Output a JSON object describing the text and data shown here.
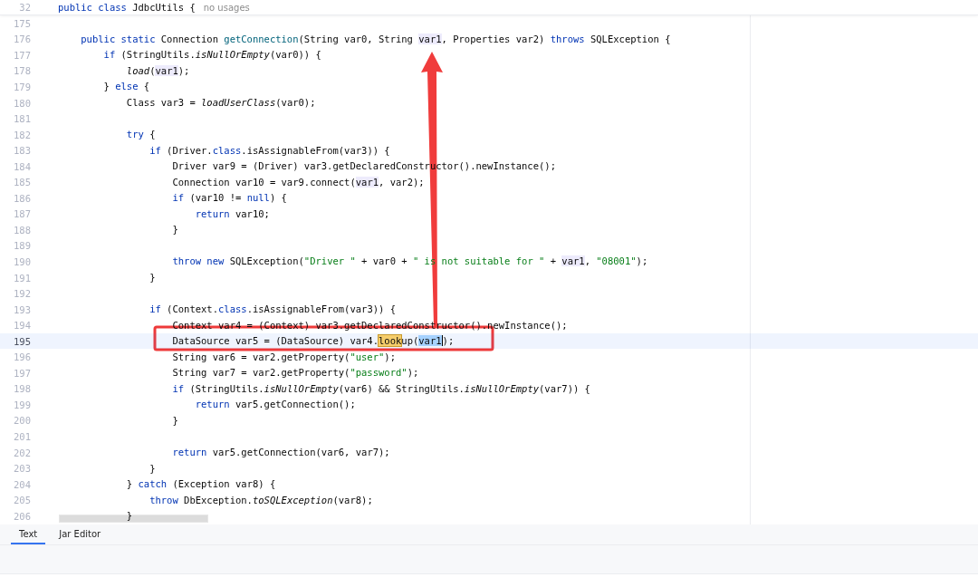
{
  "sticky_header": {
    "number": "32",
    "tokens": [
      {
        "text": "public class",
        "kind": "keyword"
      },
      {
        "text": " JdbcUtils {",
        "kind": "plain"
      }
    ],
    "hint": "no usages"
  },
  "lines": [
    {
      "number": "175",
      "current": false
    },
    {
      "number": "176",
      "current": false,
      "tokens": [
        {
          "text": "    public static",
          "kind": "keyword"
        },
        {
          "text": " Connection ",
          "kind": "plain"
        },
        {
          "text": "getConnection",
          "kind": "declaration"
        },
        {
          "text": "(String var0, String ",
          "kind": "plain"
        },
        {
          "text": "var1",
          "kind": "usage"
        },
        {
          "text": ", Properties var2) ",
          "kind": "plain"
        },
        {
          "text": "throws",
          "kind": "keyword"
        },
        {
          "text": " SQLException {",
          "kind": "plain"
        }
      ]
    },
    {
      "number": "177",
      "current": false,
      "tokens": [
        {
          "text": "        if",
          "kind": "keyword"
        },
        {
          "text": " (StringUtils.",
          "kind": "plain"
        },
        {
          "text": "isNullOrEmpty",
          "kind": "static"
        },
        {
          "text": "(var0)) {",
          "kind": "plain"
        }
      ]
    },
    {
      "number": "178",
      "current": false,
      "tokens": [
        {
          "text": "            load",
          "kind": "static"
        },
        {
          "text": "(",
          "kind": "plain"
        },
        {
          "text": "var1",
          "kind": "usage"
        },
        {
          "text": ");",
          "kind": "plain"
        }
      ]
    },
    {
      "number": "179",
      "current": false,
      "tokens": [
        {
          "text": "        } ",
          "kind": "plain"
        },
        {
          "text": "else",
          "kind": "keyword"
        },
        {
          "text": " {",
          "kind": "plain"
        }
      ]
    },
    {
      "number": "180",
      "current": false,
      "tokens": [
        {
          "text": "            Class var3 = ",
          "kind": "plain"
        },
        {
          "text": "loadUserClass",
          "kind": "static"
        },
        {
          "text": "(var0);",
          "kind": "plain"
        }
      ]
    },
    {
      "number": "181",
      "current": false
    },
    {
      "number": "182",
      "current": false,
      "tokens": [
        {
          "text": "            try",
          "kind": "keyword"
        },
        {
          "text": " {",
          "kind": "plain"
        }
      ]
    },
    {
      "number": "183",
      "current": false,
      "tokens": [
        {
          "text": "                if",
          "kind": "keyword"
        },
        {
          "text": " (Driver.",
          "kind": "plain"
        },
        {
          "text": "class",
          "kind": "keyword"
        },
        {
          "text": ".isAssignableFrom(var3)) {",
          "kind": "plain"
        }
      ]
    },
    {
      "number": "184",
      "current": false,
      "tokens": [
        {
          "text": "                    Driver var9 = (Driver) var3.getDeclaredConstructor().newInstance();",
          "kind": "plain"
        }
      ]
    },
    {
      "number": "185",
      "current": false,
      "tokens": [
        {
          "text": "                    Connection var10 = var9.connect(",
          "kind": "plain"
        },
        {
          "text": "var1",
          "kind": "usage"
        },
        {
          "text": ", var2);",
          "kind": "plain"
        }
      ]
    },
    {
      "number": "186",
      "current": false,
      "tokens": [
        {
          "text": "                    if",
          "kind": "keyword"
        },
        {
          "text": " (var10 != ",
          "kind": "plain"
        },
        {
          "text": "null",
          "kind": "keyword"
        },
        {
          "text": ") {",
          "kind": "plain"
        }
      ]
    },
    {
      "number": "187",
      "current": false,
      "tokens": [
        {
          "text": "                        return",
          "kind": "keyword"
        },
        {
          "text": " var10;",
          "kind": "plain"
        }
      ]
    },
    {
      "number": "188",
      "current": false,
      "tokens": [
        {
          "text": "                    }",
          "kind": "plain"
        }
      ]
    },
    {
      "number": "189",
      "current": false
    },
    {
      "number": "190",
      "current": false,
      "tokens": [
        {
          "text": "                    throw new",
          "kind": "keyword"
        },
        {
          "text": " SQLException(",
          "kind": "plain"
        },
        {
          "text": "\"Driver \"",
          "kind": "string"
        },
        {
          "text": " + var0 + ",
          "kind": "plain"
        },
        {
          "text": "\" is not suitable for \"",
          "kind": "string"
        },
        {
          "text": " + ",
          "kind": "plain"
        },
        {
          "text": "var1",
          "kind": "usage"
        },
        {
          "text": ", ",
          "kind": "plain"
        },
        {
          "text": "\"08001\"",
          "kind": "string"
        },
        {
          "text": ");",
          "kind": "plain"
        }
      ]
    },
    {
      "number": "191",
      "current": false,
      "tokens": [
        {
          "text": "                }",
          "kind": "plain"
        }
      ]
    },
    {
      "number": "192",
      "current": false
    },
    {
      "number": "193",
      "current": false,
      "tokens": [
        {
          "text": "                if",
          "kind": "keyword"
        },
        {
          "text": " (Context.",
          "kind": "plain"
        },
        {
          "text": "class",
          "kind": "keyword"
        },
        {
          "text": ".isAssignableFrom(var3)) {",
          "kind": "plain"
        }
      ]
    },
    {
      "number": "194",
      "current": false,
      "tokens": [
        {
          "text": "                    Context var4 = (Context) var3.getDeclaredConstructor().newInstance();",
          "kind": "plain"
        }
      ]
    },
    {
      "number": "195",
      "current": true,
      "tokens": [
        {
          "text": "                    DataSource var5 = (DataSource) var4.",
          "kind": "plain"
        },
        {
          "text": "look",
          "kind": "match"
        },
        {
          "text": "up(",
          "kind": "plain"
        },
        {
          "text": "var1",
          "kind": "selection",
          "caret": true
        },
        {
          "text": ");",
          "kind": "plain"
        }
      ]
    },
    {
      "number": "196",
      "current": false,
      "tokens": [
        {
          "text": "                    String var6 = var2.getProperty(",
          "kind": "plain"
        },
        {
          "text": "\"user\"",
          "kind": "string"
        },
        {
          "text": ");",
          "kind": "plain"
        }
      ]
    },
    {
      "number": "197",
      "current": false,
      "tokens": [
        {
          "text": "                    String var7 = var2.getProperty(",
          "kind": "plain"
        },
        {
          "text": "\"password\"",
          "kind": "string"
        },
        {
          "text": ");",
          "kind": "plain"
        }
      ]
    },
    {
      "number": "198",
      "current": false,
      "tokens": [
        {
          "text": "                    if",
          "kind": "keyword"
        },
        {
          "text": " (StringUtils.",
          "kind": "plain"
        },
        {
          "text": "isNullOrEmpty",
          "kind": "static"
        },
        {
          "text": "(var6) && StringUtils.",
          "kind": "plain"
        },
        {
          "text": "isNullOrEmpty",
          "kind": "static"
        },
        {
          "text": "(var7)) {",
          "kind": "plain"
        }
      ]
    },
    {
      "number": "199",
      "current": false,
      "tokens": [
        {
          "text": "                        return",
          "kind": "keyword"
        },
        {
          "text": " var5.getConnection();",
          "kind": "plain"
        }
      ]
    },
    {
      "number": "200",
      "current": false,
      "tokens": [
        {
          "text": "                    }",
          "kind": "plain"
        }
      ]
    },
    {
      "number": "201",
      "current": false
    },
    {
      "number": "202",
      "current": false,
      "tokens": [
        {
          "text": "                    return",
          "kind": "keyword"
        },
        {
          "text": " var5.getConnection(var6, var7);",
          "kind": "plain"
        }
      ]
    },
    {
      "number": "203",
      "current": false,
      "tokens": [
        {
          "text": "                }",
          "kind": "plain"
        }
      ]
    },
    {
      "number": "204",
      "current": false,
      "tokens": [
        {
          "text": "            } ",
          "kind": "plain"
        },
        {
          "text": "catch",
          "kind": "keyword"
        },
        {
          "text": " (Exception var8) {",
          "kind": "plain"
        }
      ]
    },
    {
      "number": "205",
      "current": false,
      "tokens": [
        {
          "text": "                throw",
          "kind": "keyword"
        },
        {
          "text": " DbException.",
          "kind": "plain"
        },
        {
          "text": "toSQLException",
          "kind": "static"
        },
        {
          "text": "(var8);",
          "kind": "plain"
        }
      ]
    },
    {
      "number": "206",
      "current": false,
      "tokens": [
        {
          "text": "            }",
          "kind": "plain"
        }
      ]
    }
  ],
  "tabs": [
    {
      "label": "Text",
      "selected": true
    },
    {
      "label": "Jar Editor",
      "selected": false
    }
  ]
}
